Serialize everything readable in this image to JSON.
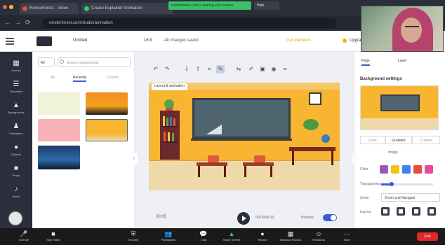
{
  "browser": {
    "tabs": [
      {
        "label": "Renderforest - Video"
      },
      {
        "label": "Create Explainer Animation"
      }
    ],
    "new_tab": "+",
    "url": "renderforest.com/studio/animation",
    "share_banner": "renderforest.com is sharing your screen",
    "share_hide": "Hide"
  },
  "appbar": {
    "project_name": "Untitled",
    "ratio": "16:9",
    "saved": "All changes saved",
    "premium": "Get premium",
    "upgrade": "Upgrade"
  },
  "iconbar": [
    {
      "label": "Scenes",
      "icon": "▦"
    },
    {
      "label": "Templates",
      "icon": "☰"
    },
    {
      "label": "Backgrounds",
      "icon": "▲"
    },
    {
      "label": "Characters",
      "icon": "♟"
    },
    {
      "label": "Objects",
      "icon": "●"
    },
    {
      "label": "Props",
      "icon": "■"
    },
    {
      "label": "Music",
      "icon": "♪"
    }
  ],
  "library": {
    "select": "All",
    "search_placeholder": "Search backgrounds",
    "tabs": [
      "All",
      "Recently",
      "Custom"
    ]
  },
  "canvas": {
    "label": "Layout & animation"
  },
  "playbar": {
    "duration": "00:05",
    "time": "00:00/00:10",
    "preview_label": "Preview"
  },
  "props": {
    "tabs": [
      "Page",
      "Layer"
    ],
    "heading": "Background settings",
    "segments": [
      "Color",
      "Gradient",
      "Custom"
    ],
    "image_label": "Image",
    "color_label": "Color",
    "transparency_label": "Transparency",
    "zoom_label": "Zoom",
    "zoom_value": "Zoom and Navigate",
    "layout_label": "Layout",
    "swatches": [
      "#9b59b6",
      "#f1c40f",
      "#3b82f6",
      "#e74c3c",
      "#ec4899"
    ]
  },
  "zoom": {
    "buttons": [
      {
        "label": "Unmute",
        "icon": "🎤"
      },
      {
        "label": "Stop Video",
        "icon": "■"
      },
      {
        "label": "Security",
        "icon": "⛨"
      },
      {
        "label": "Participants",
        "icon": "👥"
      },
      {
        "label": "Chat",
        "icon": "💬"
      },
      {
        "label": "Share Screen",
        "icon": "▲"
      },
      {
        "label": "Record",
        "icon": "●"
      },
      {
        "label": "Breakout Rooms",
        "icon": "▦"
      },
      {
        "label": "Reactions",
        "icon": "☺"
      },
      {
        "label": "More",
        "icon": "⋯"
      }
    ],
    "end": "End"
  }
}
